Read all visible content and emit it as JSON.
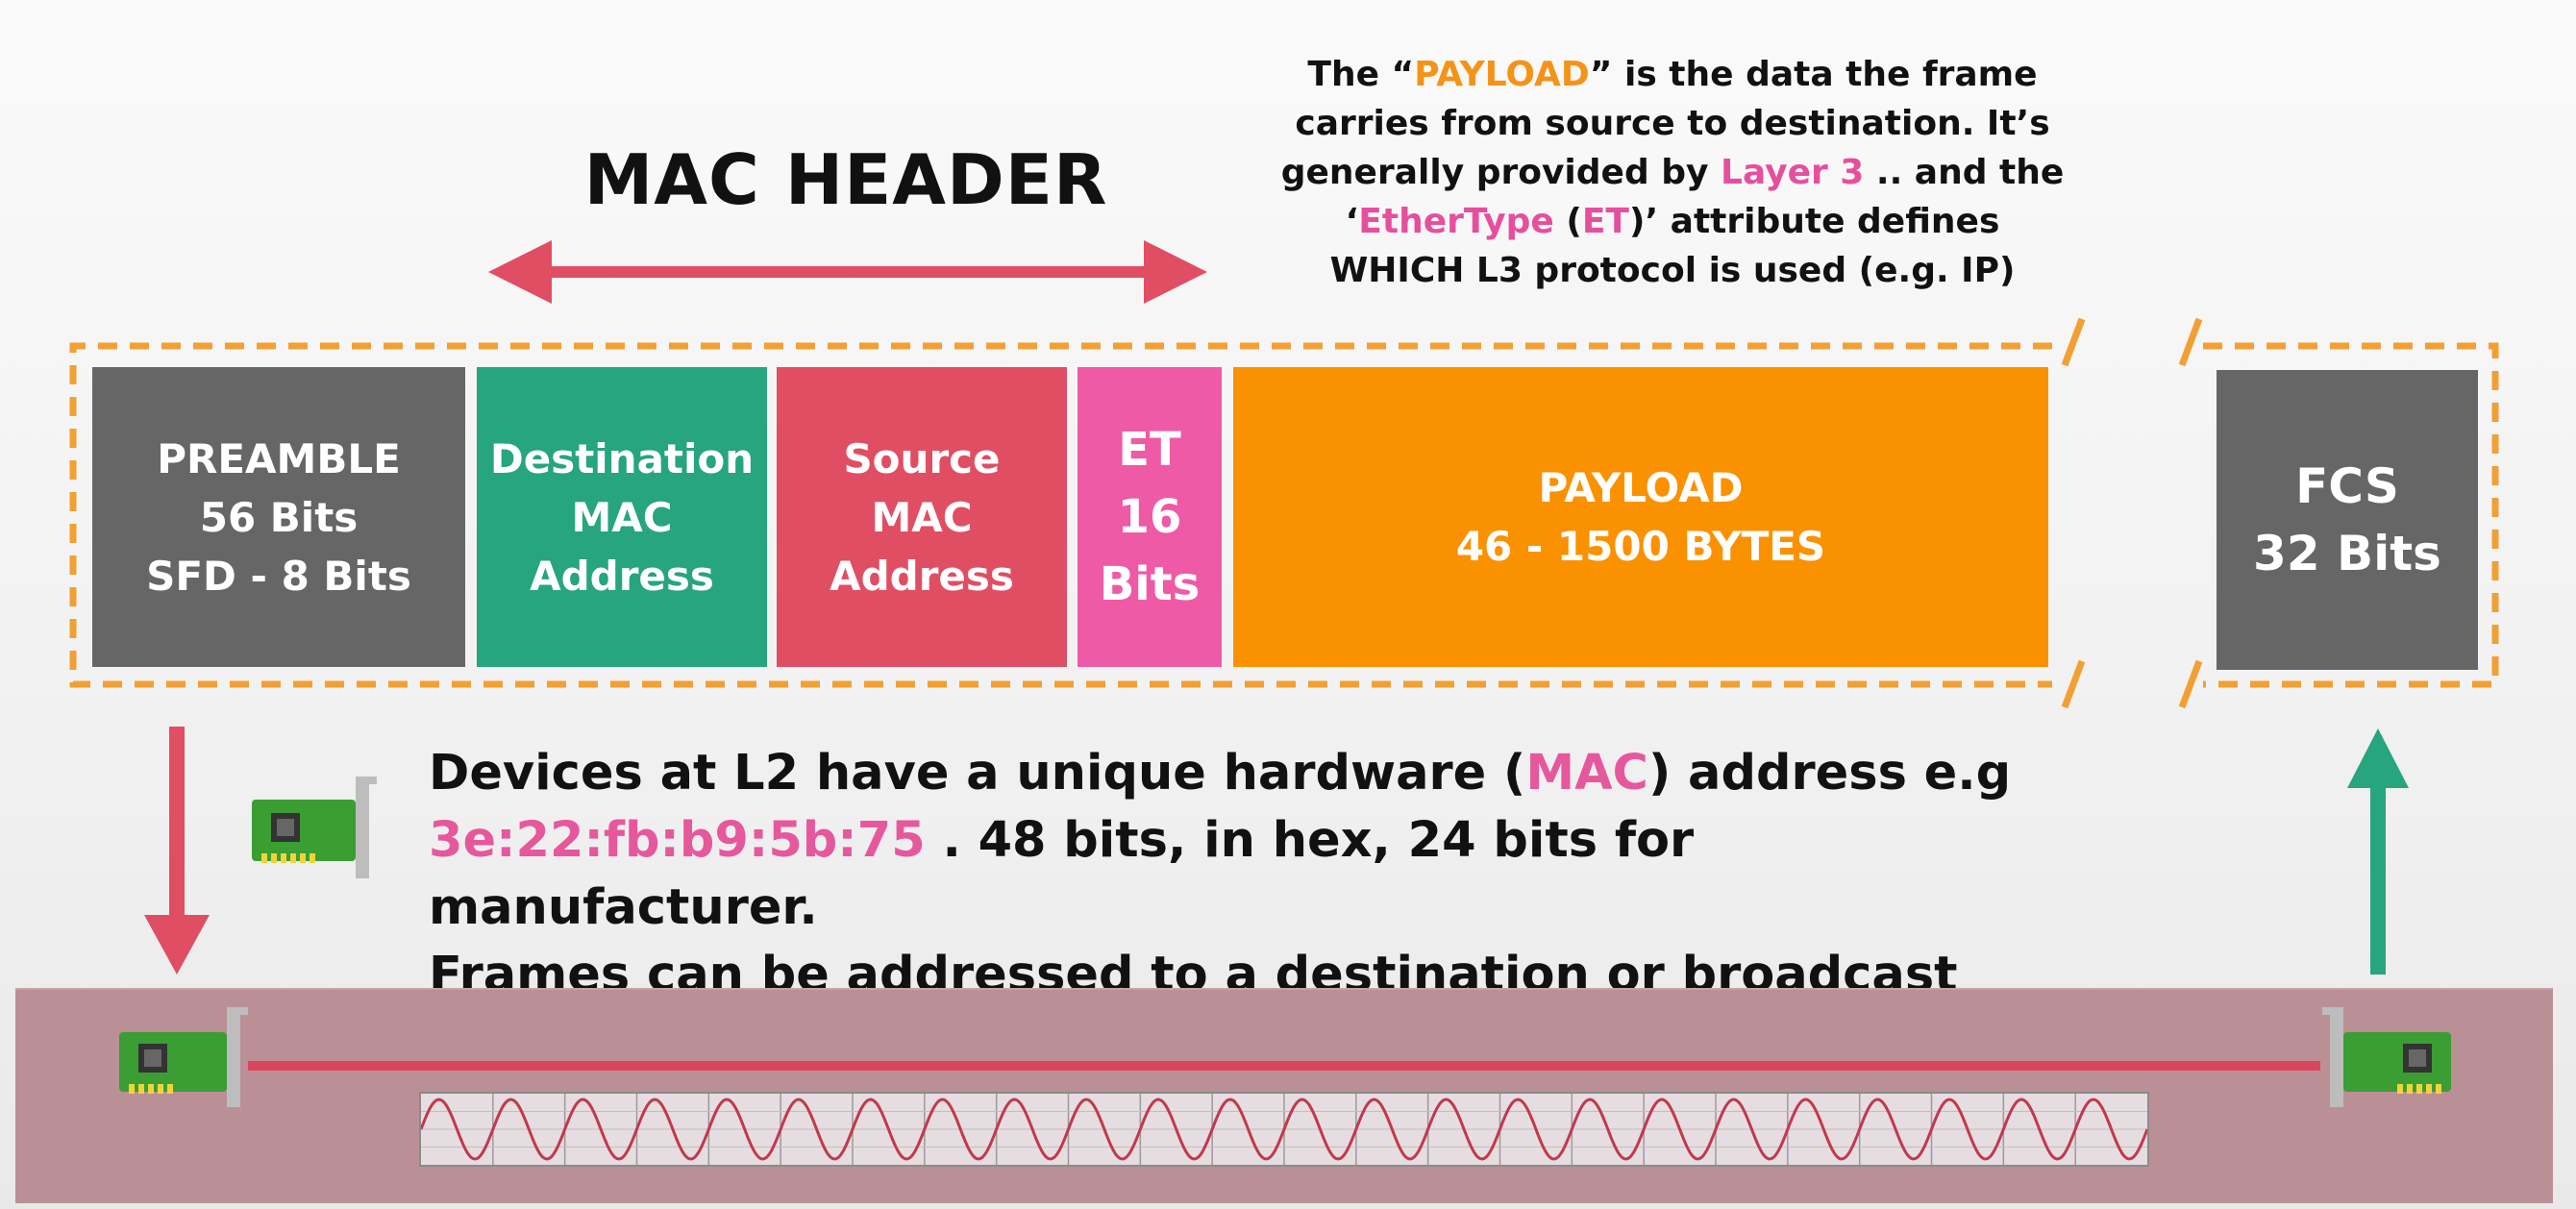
{
  "header": {
    "title": "MAC HEADER"
  },
  "payload_note": {
    "line1_a": "The “",
    "line1_payload": "PAYLOAD",
    "line1_b": "” is the data the frame",
    "line2": "carries from source to destination. It’s",
    "line3_a": "generally provided by ",
    "line3_layer": "Layer 3",
    "line3_b": " .. and the",
    "line4_a": "‘",
    "line4_ethertype": "EtherType",
    "line4_b": " (",
    "line4_et": "ET",
    "line4_c": ")’ attribute defines",
    "line5": "WHICH L3 protocol is used (e.g. IP)"
  },
  "frame": {
    "preamble": {
      "line1": "PREAMBLE",
      "line2": "56 Bits",
      "line3": "SFD - 8 Bits",
      "color": "#666666"
    },
    "destination": {
      "line1": "Destination",
      "line2": "MAC",
      "line3": "Address",
      "color": "#26a57f"
    },
    "source": {
      "line1": "Source",
      "line2": "MAC",
      "line3": "Address",
      "color": "#e04e63"
    },
    "ethertype": {
      "line1": "ET",
      "line2": "16",
      "line3": "Bits",
      "color": "#ee5aa5"
    },
    "payload": {
      "line1": "PAYLOAD",
      "line2": "46 - 1500 BYTES",
      "color": "#fa9100"
    },
    "fcs": {
      "line1": "FCS",
      "line2": "32 Bits",
      "color": "#666666"
    },
    "border_color": "#f2a033"
  },
  "devices_text": {
    "line1_a": "Devices at L2 have a unique hardware (",
    "line1_mac": "MAC",
    "line1_b": ") address e.g",
    "line2_addr": "3e:22:fb:b9:5b:75",
    "line2_b": " . 48 bits, in hex, 24 bits for manufacturer.",
    "line3": "Frames can be addressed to a destination or broadcast (ALL F’s)"
  },
  "icons": {
    "down_arrow": "red-down-arrow-icon",
    "up_arrow": "green-up-arrow-icon",
    "nic": "network-card-icon"
  },
  "colors": {
    "arrow_red": "#e04e63",
    "arrow_green": "#26a57f",
    "medium": "#bb8f96",
    "cable": "#d9455a"
  }
}
